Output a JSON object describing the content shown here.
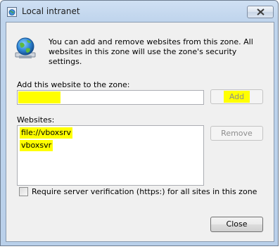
{
  "window": {
    "title": "Local intranet",
    "close_label": "×"
  },
  "intro_text": "You can add and remove websites from this zone. All websites in this zone will use the zone's security settings.",
  "add_section": {
    "label": "Add this website to the zone:",
    "input_value": "",
    "add_button": "Add"
  },
  "websites": {
    "label": "Websites:",
    "items": [
      "file://vboxsrv",
      "vboxsvr"
    ],
    "remove_button": "Remove"
  },
  "require_https": {
    "label": "Require server verification (https:) for all sites in this zone",
    "checked": false
  },
  "footer": {
    "close_button": "Close"
  },
  "colors": {
    "highlight": "#ffff00",
    "title_bar": "#bfd4ec",
    "client_bg": "#f0f0f0"
  },
  "icons": {
    "title": "globe-window-icon",
    "zone": "globe-icon",
    "close": "close-icon"
  }
}
